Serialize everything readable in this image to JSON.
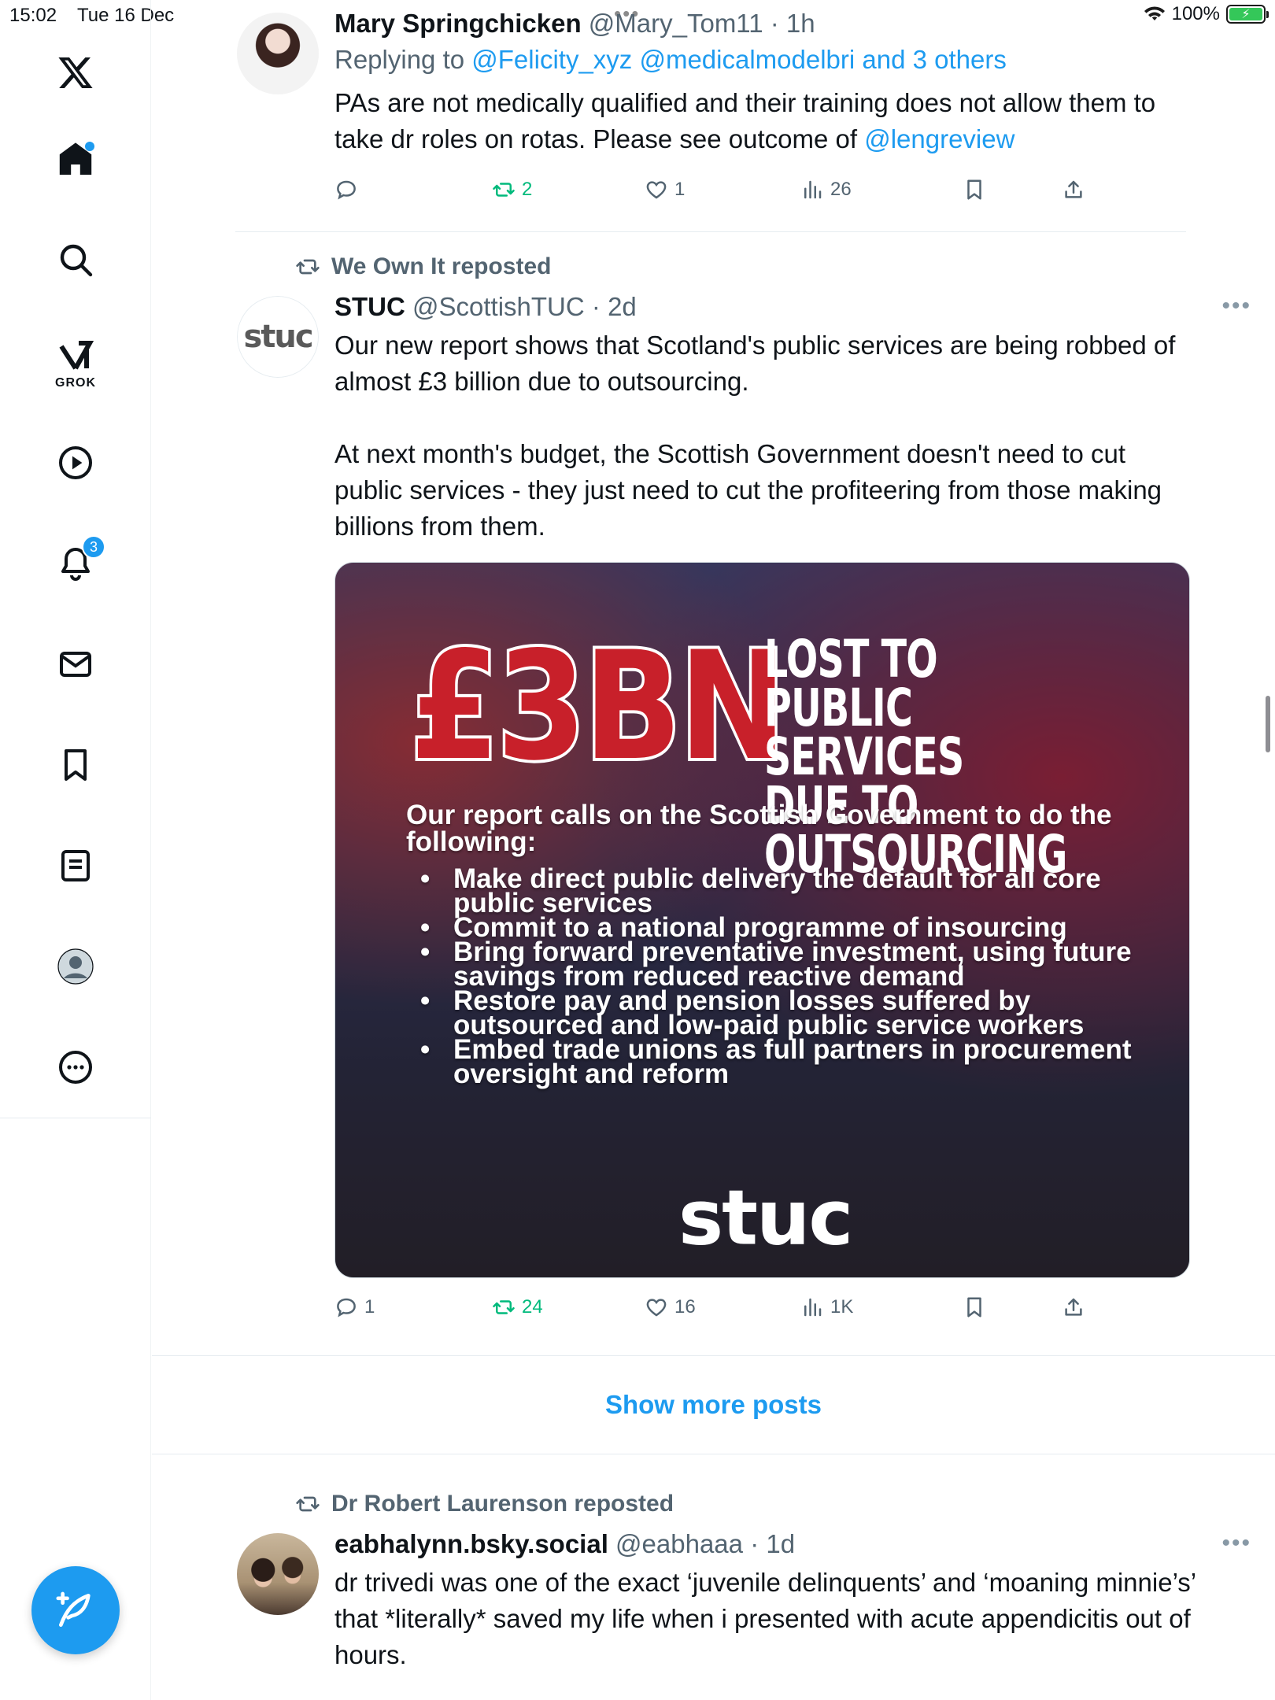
{
  "status_bar": {
    "time": "15:02",
    "date": "Tue 16 Dec",
    "dots": "•••",
    "battery": "100%"
  },
  "sidebar": {
    "items": [
      {
        "name": "x-logo",
        "icon": "x-logo-icon"
      },
      {
        "name": "home",
        "icon": "home-icon"
      },
      {
        "name": "explore",
        "icon": "search-icon"
      },
      {
        "name": "grok",
        "icon": "grok-icon",
        "label": "GROK"
      },
      {
        "name": "video",
        "icon": "play-icon"
      },
      {
        "name": "notifications",
        "icon": "bell-icon",
        "badge": "3"
      },
      {
        "name": "messages",
        "icon": "mail-icon"
      },
      {
        "name": "bookmarks",
        "icon": "bookmark-icon"
      },
      {
        "name": "lists",
        "icon": "list-icon"
      },
      {
        "name": "profile",
        "icon": "profile-icon"
      },
      {
        "name": "more",
        "icon": "more-icon"
      }
    ],
    "compose_icon": "compose-icon"
  },
  "posts": [
    {
      "author_name": "Mary Springchicken",
      "handle": "@Mary_Tom11",
      "time": "· 1h",
      "reply_prefix": "Replying to ",
      "reply_targets": "@Felicity_xyz @medicalmodelbri and 3 others",
      "text_1": "PAs are not medically qualified and their training does not allow them to take dr roles on rotas. Please see outcome of ",
      "text_link": "@lengreview",
      "replies": "",
      "reposts": "2",
      "likes": "1",
      "views": "26"
    },
    {
      "reposted_by": "We Own It reposted",
      "author_name": "STUC",
      "handle": "@ScottishTUC",
      "time": "· 2d",
      "avatar_text": "stuc",
      "paragraph_1": "Our new report shows that Scotland's public services are being robbed of almost £3 billion due to outsourcing.",
      "paragraph_2": "At next month's budget, the Scottish Government doesn't need to cut public services - they just need to cut the profiteering from those making billions from them.",
      "media": {
        "amount": "£3BN",
        "headline": "LOST TO PUBLIC SERVICES DUE TO OUTSOURCING",
        "intro": "Our report calls on the Scottish Government to do  the following:",
        "bullets": [
          "Make direct public delivery the default for all core public services",
          "Commit to a national programme of insourcing",
          "Bring forward preventative investment, using future savings from reduced reactive demand",
          "Restore pay and pension losses suffered by outsourced and low-paid public service workers",
          "Embed trade unions as full partners in procurement oversight and reform"
        ],
        "logo": "stuc"
      },
      "replies": "1",
      "reposts": "24",
      "likes": "16",
      "views": "1K"
    },
    {
      "reposted_by": "Dr Robert Laurenson reposted",
      "author_name": "eabhalynn.bsky.social",
      "handle": "@eabhaaa",
      "time": "· 1d",
      "text": "dr trivedi was one of the exact ‘juvenile delinquents’ and ‘moaning minnie’s’ that *literally* saved my life when i presented with acute appendicitis out of hours."
    }
  ],
  "show_more": "Show more posts",
  "colors": {
    "accent": "#1d9bf0",
    "repost_green": "#00ba7c",
    "muted": "#536471",
    "media_red": "#c8202a"
  }
}
